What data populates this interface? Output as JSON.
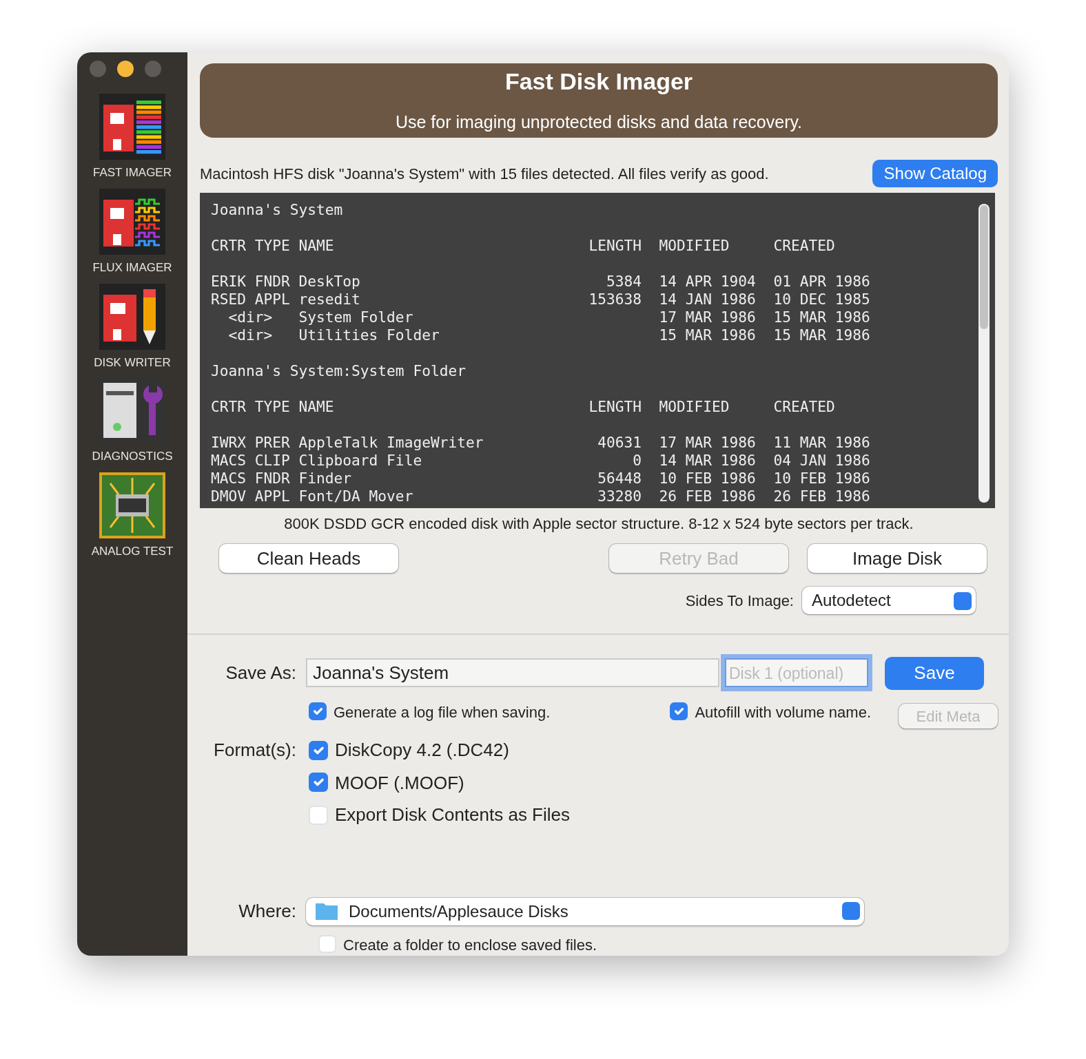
{
  "sidebar": {
    "items": [
      {
        "label": "FAST IMAGER",
        "kind": "fast"
      },
      {
        "label": "FLUX IMAGER",
        "kind": "flux"
      },
      {
        "label": "DISK WRITER",
        "kind": "writer"
      },
      {
        "label": "DIAGNOSTICS",
        "kind": "diag"
      },
      {
        "label": "ANALOG TEST",
        "kind": "analog"
      }
    ]
  },
  "banner": {
    "title": "Fast Disk Imager",
    "subtitle": "Use for imaging unprotected disks and data recovery."
  },
  "status": "Macintosh HFS disk \"Joanna's System\" with 15 files detected. All files verify as good.",
  "show_catalog_button": "Show Catalog",
  "listing": [
    {
      "title": "Joanna's System",
      "header": "CRTR TYPE NAME                             LENGTH  MODIFIED     CREATED",
      "lines": [
        "ERIK FNDR DeskTop                            5384  14 APR 1904  01 APR 1986",
        "RSED APPL resedit                          153638  14 JAN 1986  10 DEC 1985",
        "  <dir>   System Folder                            17 MAR 1986  15 MAR 1986",
        "  <dir>   Utilities Folder                         15 MAR 1986  15 MAR 1986"
      ]
    },
    {
      "title": "Joanna's System:System Folder",
      "header": "CRTR TYPE NAME                             LENGTH  MODIFIED     CREATED",
      "lines": [
        "IWRX PRER AppleTalk ImageWriter             40631  17 MAR 1986  11 MAR 1986",
        "MACS CLIP Clipboard File                        0  14 MAR 1986  04 JAN 1986",
        "MACS FNDR Finder                            56448  10 FEB 1986  10 FEB 1986",
        "DMOV APPL Font/DA Mover                     33280  26 FEB 1986  26 FEB 1986"
      ]
    }
  ],
  "disk_info": "800K DSDD GCR encoded disk with Apple sector structure. 8-12 x 524 byte sectors per track.",
  "actions": [
    {
      "label": "Clean Heads",
      "disabled": false
    },
    {
      "label": "Retry Bad",
      "disabled": true
    },
    {
      "label": "Image Disk",
      "disabled": false
    }
  ],
  "sides": {
    "label": "Sides To Image:",
    "value": "Autodetect"
  },
  "save_as": {
    "label": "Save As:",
    "value": "Joanna's System",
    "disk_placeholder": "Disk 1 (optional)",
    "save_button": "Save",
    "edit_meta_button": "Edit Meta",
    "edit_meta_disabled": true,
    "options": [
      {
        "label": "Generate a log file when saving.",
        "checked": true
      },
      {
        "label": "Autofill with volume name.",
        "checked": true
      }
    ]
  },
  "formats": {
    "label": "Format(s):",
    "items": [
      {
        "label": "DiskCopy 4.2 (.DC42)",
        "checked": true
      },
      {
        "label": "MOOF (.MOOF)",
        "checked": true
      },
      {
        "label": "Export Disk Contents as Files",
        "checked": false
      }
    ]
  },
  "where": {
    "label": "Where:",
    "value": "Documents/Applesauce Disks",
    "folder_option": {
      "label": "Create a folder to enclose saved files.",
      "checked": false
    }
  }
}
